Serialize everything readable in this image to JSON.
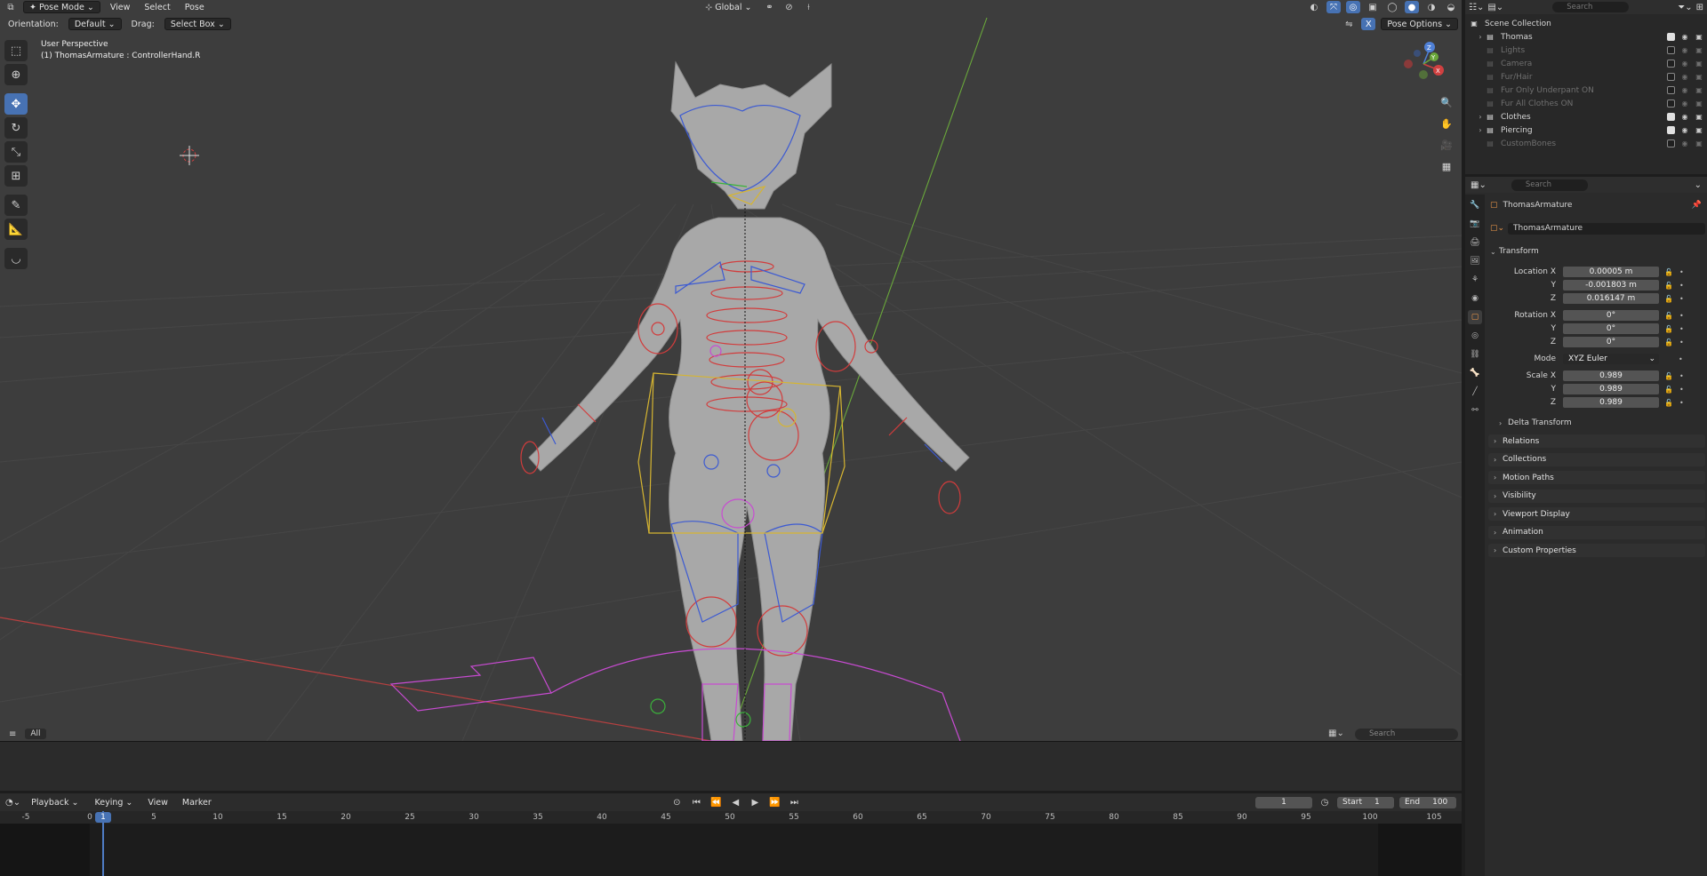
{
  "viewport": {
    "mode_label": "Pose Mode",
    "menus": [
      "View",
      "Select",
      "Pose"
    ],
    "transform_orientation": "Global",
    "orientation_label": "Orientation:",
    "orientation_value": "Default",
    "drag_label": "Drag:",
    "drag_value": "Select Box",
    "pose_options": "Pose Options",
    "perspective": "User Perspective",
    "active_object": "(1) ThomasArmature : ControllerHand.R",
    "gizmo_axes": [
      "X",
      "Y",
      "Z"
    ],
    "bottom_tab": "All",
    "search_placeholder": "Search"
  },
  "timeline": {
    "menus": [
      "Playback",
      "Keying",
      "View",
      "Marker"
    ],
    "current_frame": "1",
    "start_label": "Start",
    "start_value": "1",
    "end_label": "End",
    "end_value": "100",
    "ruler_ticks": [
      "-5",
      "0",
      "5",
      "10",
      "15",
      "20",
      "25",
      "30",
      "35",
      "40",
      "45",
      "50",
      "55",
      "60",
      "65",
      "70",
      "75",
      "80",
      "85",
      "90",
      "95",
      "100",
      "105"
    ],
    "playhead_frame": "1"
  },
  "outliner": {
    "search_placeholder": "Search",
    "scene_collection": "Scene Collection",
    "items": [
      {
        "name": "Thomas",
        "checked": true,
        "dim": false
      },
      {
        "name": "Lights",
        "checked": false,
        "dim": true
      },
      {
        "name": "Camera",
        "checked": false,
        "dim": true
      },
      {
        "name": "Fur/Hair",
        "checked": false,
        "dim": true
      },
      {
        "name": "Fur Only Underpant ON",
        "checked": false,
        "dim": true
      },
      {
        "name": "Fur All Clothes ON",
        "checked": false,
        "dim": true
      },
      {
        "name": "Clothes",
        "checked": true,
        "dim": false
      },
      {
        "name": "Piercing",
        "checked": true,
        "dim": false
      },
      {
        "name": "CustomBones",
        "checked": false,
        "dim": true
      }
    ]
  },
  "properties": {
    "search_placeholder": "Search",
    "object_name": "ThomasArmature",
    "data_name": "ThomasArmature",
    "transform_label": "Transform",
    "location_label": "Location X",
    "location": {
      "x": "0.00005 m",
      "y": "-0.001803 m",
      "z": "0.016147 m"
    },
    "rotation_label": "Rotation X",
    "rotation": {
      "x": "0°",
      "y": "0°",
      "z": "0°"
    },
    "mode_label": "Mode",
    "mode_value": "XYZ Euler",
    "scale_label": "Scale X",
    "scale": {
      "x": "0.989",
      "y": "0.989",
      "z": "0.989"
    },
    "axis_y": "Y",
    "axis_z": "Z",
    "delta_transform": "Delta Transform",
    "panels": [
      "Relations",
      "Collections",
      "Motion Paths",
      "Visibility",
      "Viewport Display",
      "Animation",
      "Custom Properties"
    ]
  },
  "colors": {
    "accent": "#4772b3",
    "viewport_bg": "#3d3d3d",
    "bone_red": "#d23c3c",
    "bone_blue": "#3c5ad2",
    "bone_yellow": "#d6b531",
    "bone_magenta": "#c84bd2"
  }
}
